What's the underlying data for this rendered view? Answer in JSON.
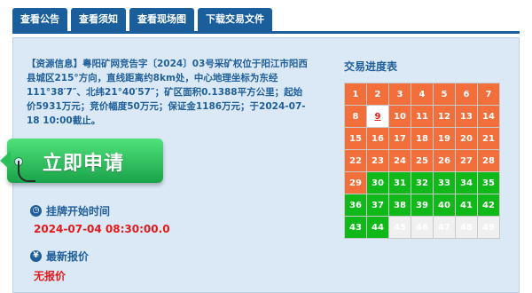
{
  "tabs": [
    {
      "label": "查看公告"
    },
    {
      "label": "查看须知"
    },
    {
      "label": "查看现场图"
    },
    {
      "label": "下载交易文件"
    }
  ],
  "description": "【资源信息】粤阳矿网竞告字〔2024〕03号采矿权位于阳江市阳西县城区215°方向，直线距离约8km处，中心地理坐标为东经111°38′7″、北纬21°40′57″；矿区面积0.1388平方公里；起始价5931万元；竞价幅度50万元；保证金1186万元；于2024-07-18 10:00截止。",
  "apply_button": {
    "label": "立即申请",
    "color": "#2bbf58"
  },
  "listing_start": {
    "icon": "clock-icon",
    "title": "挂牌开始时间",
    "value": "2024-07-04 08:30:00.0"
  },
  "latest_quote": {
    "icon": "yen-icon",
    "title": "最新报价",
    "value": "无报价"
  },
  "progress": {
    "title": "交易进度表",
    "current": 9,
    "colors": {
      "done": "#f26f3c",
      "active": "#10b81a",
      "pending": "#f0f0f0",
      "current_text": "#e21a1a"
    },
    "cells": [
      {
        "n": "1",
        "state": "done"
      },
      {
        "n": "2",
        "state": "done"
      },
      {
        "n": "3",
        "state": "done"
      },
      {
        "n": "4",
        "state": "done"
      },
      {
        "n": "5",
        "state": "done"
      },
      {
        "n": "6",
        "state": "done"
      },
      {
        "n": "7",
        "state": "done"
      },
      {
        "n": "8",
        "state": "done"
      },
      {
        "n": "9",
        "state": "current"
      },
      {
        "n": "10",
        "state": "done"
      },
      {
        "n": "11",
        "state": "done"
      },
      {
        "n": "12",
        "state": "done"
      },
      {
        "n": "13",
        "state": "done"
      },
      {
        "n": "14",
        "state": "done"
      },
      {
        "n": "15",
        "state": "done"
      },
      {
        "n": "16",
        "state": "done"
      },
      {
        "n": "17",
        "state": "done"
      },
      {
        "n": "18",
        "state": "done"
      },
      {
        "n": "19",
        "state": "done"
      },
      {
        "n": "20",
        "state": "done"
      },
      {
        "n": "21",
        "state": "done"
      },
      {
        "n": "22",
        "state": "done"
      },
      {
        "n": "23",
        "state": "done"
      },
      {
        "n": "24",
        "state": "done"
      },
      {
        "n": "25",
        "state": "done"
      },
      {
        "n": "26",
        "state": "done"
      },
      {
        "n": "27",
        "state": "done"
      },
      {
        "n": "28",
        "state": "done"
      },
      {
        "n": "29",
        "state": "done"
      },
      {
        "n": "30",
        "state": "active"
      },
      {
        "n": "31",
        "state": "active"
      },
      {
        "n": "32",
        "state": "active"
      },
      {
        "n": "33",
        "state": "active"
      },
      {
        "n": "34",
        "state": "active"
      },
      {
        "n": "35",
        "state": "active"
      },
      {
        "n": "36",
        "state": "active"
      },
      {
        "n": "37",
        "state": "active"
      },
      {
        "n": "38",
        "state": "active"
      },
      {
        "n": "39",
        "state": "active"
      },
      {
        "n": "40",
        "state": "active"
      },
      {
        "n": "41",
        "state": "active"
      },
      {
        "n": "42",
        "state": "active"
      },
      {
        "n": "43",
        "state": "active"
      },
      {
        "n": "44",
        "state": "active"
      },
      {
        "n": "45",
        "state": "pending"
      },
      {
        "n": "46",
        "state": "pending"
      },
      {
        "n": "47",
        "state": "pending"
      },
      {
        "n": "48",
        "state": "pending"
      },
      {
        "n": "49",
        "state": "pending"
      }
    ]
  }
}
